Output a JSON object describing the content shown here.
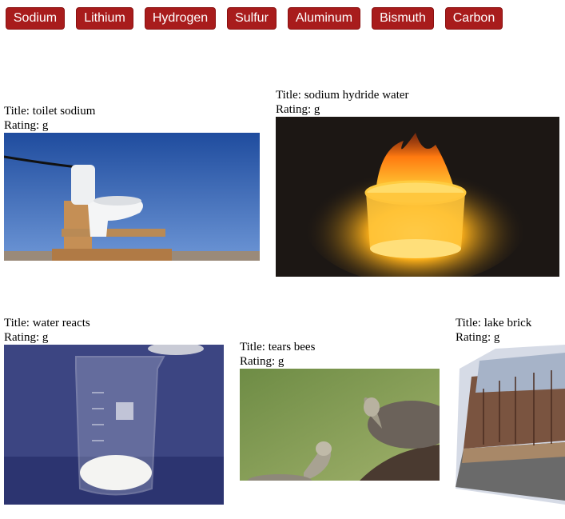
{
  "buttons": [
    "Sodium",
    "Lithium",
    "Hydrogen",
    "Sulfur",
    "Aluminum",
    "Bismuth",
    "Carbon"
  ],
  "gifs": [
    {
      "title_label": "Title: toilet sodium",
      "rating_label": "Rating: g",
      "image": "toilet-on-wooden-stand-image"
    },
    {
      "title_label": "Title: sodium hydride water",
      "rating_label": "Rating: g",
      "image": "burning-dish-image"
    },
    {
      "title_label": "Title: water reacts",
      "rating_label": "Rating: g",
      "image": "beaker-powder-image"
    },
    {
      "title_label": "Title: tears bees",
      "rating_label": "Rating: g",
      "image": "turtles-image"
    },
    {
      "title_label": "Title: lake brick",
      "rating_label": "Rating: g",
      "image": "lake-trees-image"
    }
  ],
  "colors": {
    "button_bg": "#a81c1c",
    "button_text": "#ffffff"
  }
}
